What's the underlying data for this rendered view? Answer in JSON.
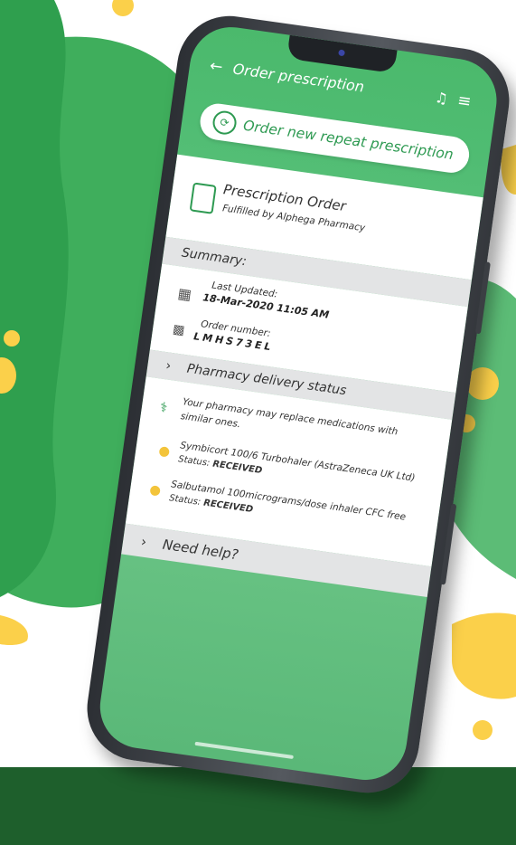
{
  "app": {
    "title": "Order prescription",
    "back_icon": "back-arrow-icon",
    "notification_icon": "bell-icon",
    "menu_icon": "menu-icon"
  },
  "repeat_button": {
    "label": "Order new repeat prescription",
    "icon": "repeat-icon"
  },
  "order_card": {
    "title": "Prescription Order",
    "subtitle": "Fulfilled by Alphega Pharmacy",
    "icon": "prescription-doc-icon"
  },
  "summary": {
    "heading": "Summary:",
    "last_updated_label": "Last Updated:",
    "last_updated_value": "18-Mar-2020 11:05 AM",
    "order_number_label": "Order number:",
    "order_number_value": "LMHS73EL"
  },
  "delivery": {
    "heading": "Pharmacy delivery status"
  },
  "meds": {
    "note": "Your pharmacy may replace medications with similar ones.",
    "status_prefix": "Status:",
    "items": [
      {
        "name": "Symbicort 100/6 Turbohaler (AstraZeneca UK Ltd)",
        "status": "RECEIVED"
      },
      {
        "name": "Salbutamol 100micrograms/dose inhaler CFC free",
        "status": "RECEIVED"
      }
    ]
  },
  "help": {
    "label": "Need help?"
  },
  "colors": {
    "brand_green": "#4bb96c",
    "accent_yellow": "#f3c43b",
    "dark_green": "#1e5f2c"
  }
}
